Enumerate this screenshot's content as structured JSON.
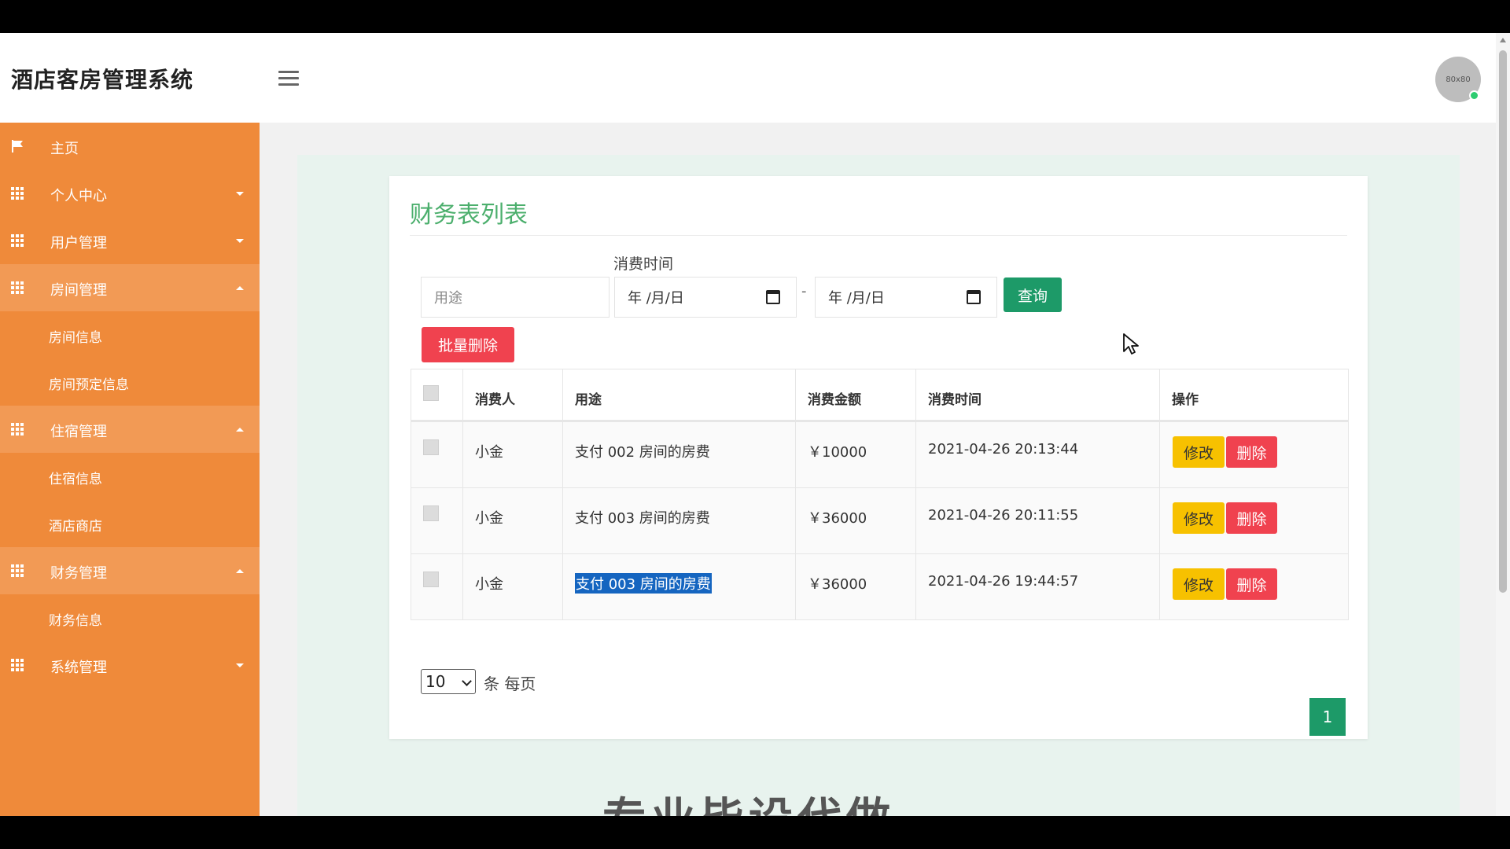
{
  "app": {
    "title": "酒店客房管理系统",
    "avatar_text": "80x80"
  },
  "sidebar": {
    "items": [
      {
        "label": "主页",
        "icon": "flag-icon"
      },
      {
        "label": "个人中心",
        "icon": "grid-icon"
      },
      {
        "label": "用户管理",
        "icon": "grid-icon"
      },
      {
        "label": "房间管理",
        "icon": "grid-icon"
      },
      {
        "label": "房间信息"
      },
      {
        "label": "房间预定信息"
      },
      {
        "label": "住宿管理",
        "icon": "grid-icon"
      },
      {
        "label": "住宿信息"
      },
      {
        "label": "酒店商店"
      },
      {
        "label": "财务管理",
        "icon": "grid-icon"
      },
      {
        "label": "财务信息"
      },
      {
        "label": "系统管理",
        "icon": "grid-icon"
      }
    ]
  },
  "page": {
    "title": "财务表列表"
  },
  "filters": {
    "time_label": "消费时间",
    "purpose_placeholder": "用途",
    "date_start": "年 /月/日",
    "date_end": "年 /月/日",
    "dash": "-",
    "query_label": "查询",
    "batch_delete_label": "批量删除"
  },
  "table": {
    "headers": [
      "消费人",
      "用途",
      "消费金额",
      "消费时间",
      "操作"
    ],
    "rows": [
      {
        "consumer": "小金",
        "purpose": "支付 002 房间的房费",
        "amount": "￥10000",
        "time": "2021-04-26 20:13:44"
      },
      {
        "consumer": "小金",
        "purpose": "支付 003 房间的房费",
        "amount": "￥36000",
        "time": "2021-04-26 20:11:55"
      },
      {
        "consumer": "小金",
        "purpose": "支付 003 房间的房费",
        "amount": "￥36000",
        "time": "2021-04-26 19:44:57"
      }
    ],
    "edit_label": "修改",
    "delete_label": "删除"
  },
  "pagination": {
    "page_size": "10",
    "per_page_text": "条 每页",
    "current_page": "1"
  },
  "watermark": "专业毕设代做",
  "colors": {
    "sidebar": "#ef8a3a",
    "accent": "#1d9a68",
    "danger": "#f0424f",
    "warning": "#f7c100",
    "title": "#4caf6d"
  }
}
